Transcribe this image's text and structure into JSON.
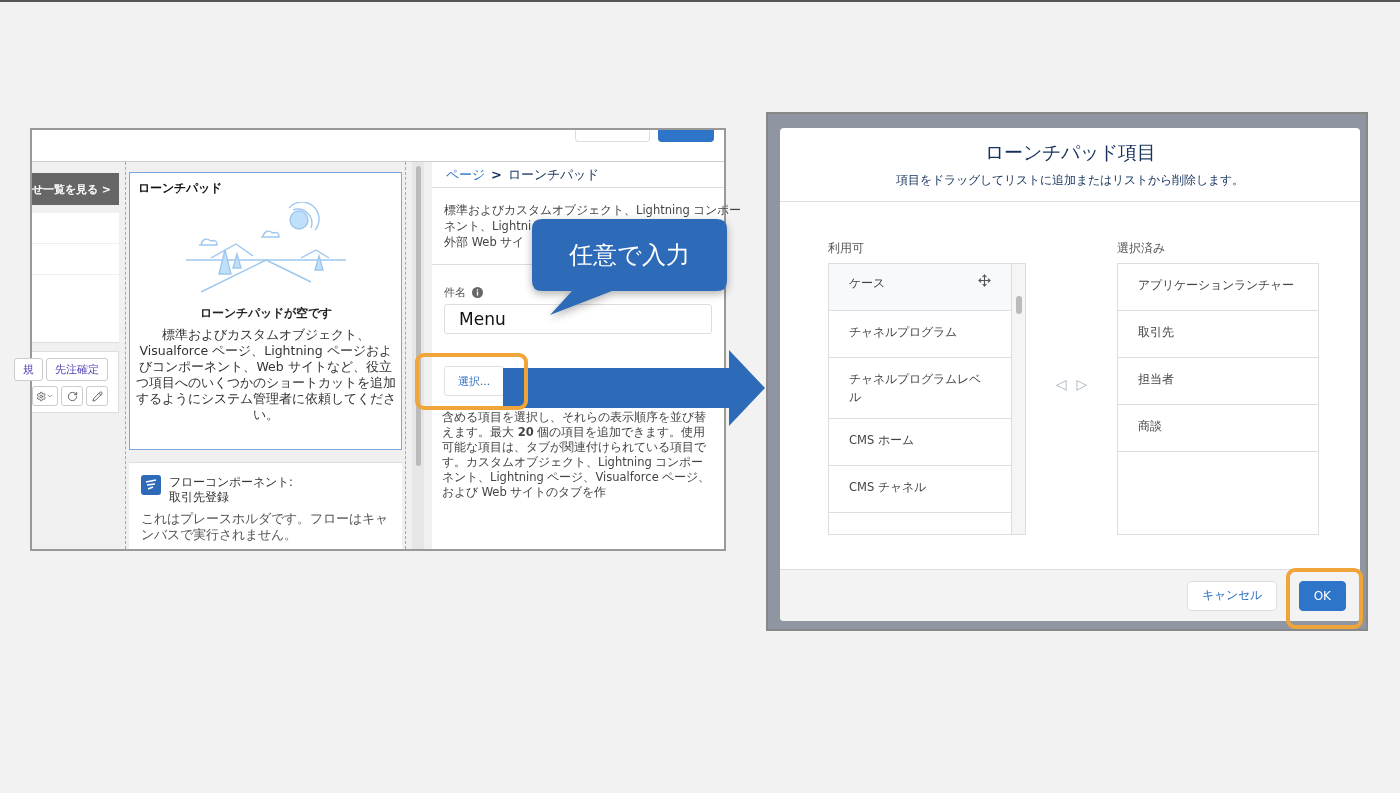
{
  "left_screenshot": {
    "sidebar": {
      "header_link": "せ一覧を見る >",
      "buttons": [
        {
          "label": "規"
        },
        {
          "label": "先注確定"
        }
      ]
    },
    "launchpad_card": {
      "title": "ローンチパッド",
      "empty_title": "ローンチパッドが空です",
      "empty_text": "標準およびカスタムオブジェクト、Visualforce ページ、Lightning ページおよびコンポーネント、Web サイトなど、役立つ項目へのいくつかのショートカットを追加するようにシステム管理者に依頼してください。"
    },
    "flow_card": {
      "title": "フローコンポーネント:",
      "subtitle": "取引先登録",
      "text": "これはプレースホルダです。フローはキャンバスで実行されません。"
    },
    "properties": {
      "breadcrumb": [
        {
          "label": "ページ",
          "kind": "link"
        },
        {
          "label": ">",
          "kind": "separator"
        },
        {
          "label": "ローンチパッド",
          "kind": "current"
        }
      ],
      "description_lines": [
        "標準およびカスタムオブジェクト、Lightning コンポー",
        "ネント、Lightni",
        "外部 Web サイ"
      ],
      "field": {
        "label": "件名",
        "value": "Menu"
      },
      "select_button": "選択...",
      "help_text": "含める項目を選択し、それらの表示順序を並び替えます。最大 **20** 個の項目を追加できます。使用可能な項目は、タブが関連付けられている項目です。カスタムオブジェクト、Lightning コンポーネント、Lightning ページ、Visualforce ページ、および Web サイトのタブを作"
    }
  },
  "callout": {
    "text": "任意で入力"
  },
  "dialog": {
    "title": "ローンチパッド項目",
    "subtitle": "項目をドラッグしてリストに追加またはリストから削除します。",
    "available": {
      "label": "利用可",
      "items": [
        {
          "label": "ケース",
          "selected": true
        },
        {
          "label": "チャネルプログラム",
          "selected": false
        },
        {
          "label": "チャネルプログラムレベル",
          "selected": false
        },
        {
          "label": "CMS ホーム",
          "selected": false
        },
        {
          "label": "CMS チャネル",
          "selected": false
        }
      ]
    },
    "move_buttons": [
      "◁",
      "▷"
    ],
    "selected": {
      "label": "選択済み",
      "items": [
        {
          "label": "アプリケーションランチャー"
        },
        {
          "label": "取引先"
        },
        {
          "label": "担当者"
        },
        {
          "label": "商談"
        }
      ]
    },
    "buttons": [
      {
        "label": "キャンセル",
        "kind": "neutral"
      },
      {
        "label": "OK",
        "kind": "brand"
      }
    ]
  }
}
